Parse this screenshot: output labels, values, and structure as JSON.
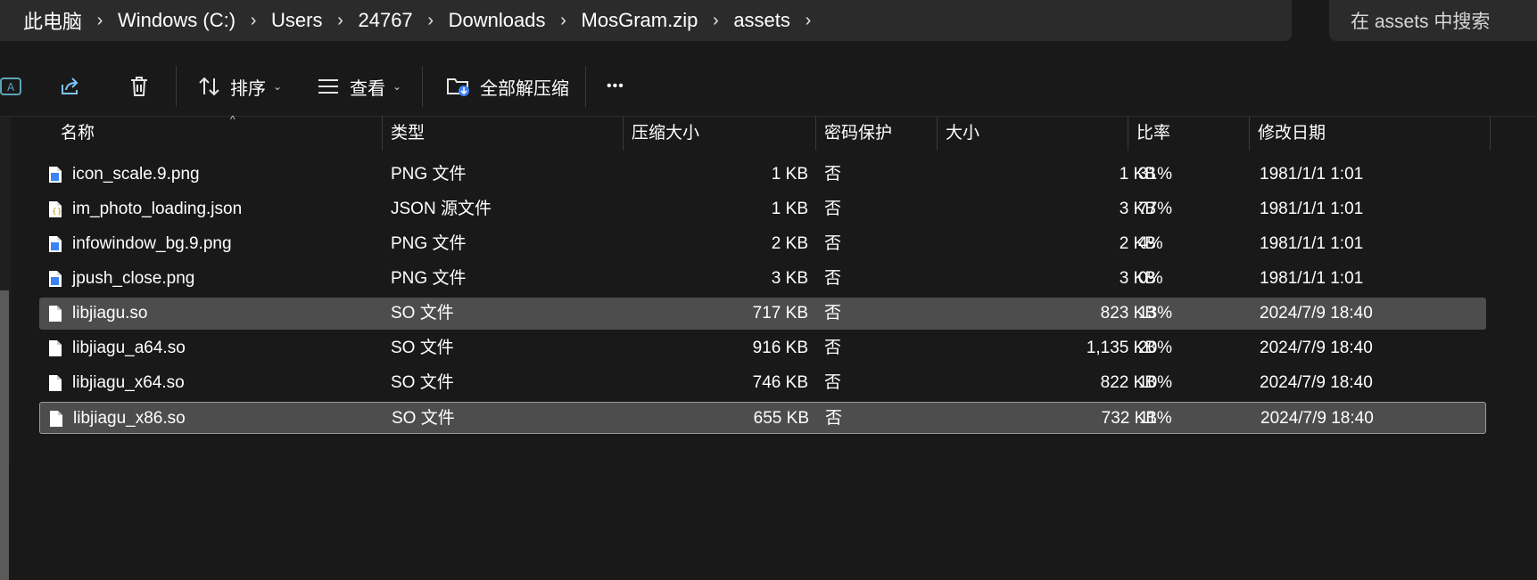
{
  "breadcrumb": [
    "此电脑",
    "Windows  (C:)",
    "Users",
    "24767",
    "Downloads",
    "MosGram.zip",
    "assets"
  ],
  "search": {
    "placeholder": "在 assets 中搜索"
  },
  "toolbar": {
    "sort_label": "排序",
    "view_label": "查看",
    "extract_label": "全部解压缩",
    "more_label": "•••"
  },
  "columns": {
    "name": "名称",
    "type": "类型",
    "compressed": "压缩大小",
    "password": "密码保护",
    "size": "大小",
    "ratio": "比率",
    "modified": "修改日期"
  },
  "files": [
    {
      "name": "icon_scale.9.png",
      "type": "PNG 文件",
      "compressed": "1 KB",
      "password": "否",
      "size": "1 KB",
      "ratio": "31%",
      "modified": "1981/1/1 1:01",
      "icon": "png-file-icon"
    },
    {
      "name": "im_photo_loading.json",
      "type": "JSON 源文件",
      "compressed": "1 KB",
      "password": "否",
      "size": "3 KB",
      "ratio": "77%",
      "modified": "1981/1/1 1:01",
      "icon": "json-file-icon"
    },
    {
      "name": "infowindow_bg.9.png",
      "type": "PNG 文件",
      "compressed": "2 KB",
      "password": "否",
      "size": "2 KB",
      "ratio": "4%",
      "modified": "1981/1/1 1:01",
      "icon": "png-file-icon"
    },
    {
      "name": "jpush_close.png",
      "type": "PNG 文件",
      "compressed": "3 KB",
      "password": "否",
      "size": "3 KB",
      "ratio": "0%",
      "modified": "1981/1/1 1:01",
      "icon": "png-file-icon"
    },
    {
      "name": "libjiagu.so",
      "type": "SO 文件",
      "compressed": "717 KB",
      "password": "否",
      "size": "823 KB",
      "ratio": "13%",
      "modified": "2024/7/9 18:40",
      "icon": "file-icon"
    },
    {
      "name": "libjiagu_a64.so",
      "type": "SO 文件",
      "compressed": "916 KB",
      "password": "否",
      "size": "1,135 KB",
      "ratio": "20%",
      "modified": "2024/7/9 18:40",
      "icon": "file-icon"
    },
    {
      "name": "libjiagu_x64.so",
      "type": "SO 文件",
      "compressed": "746 KB",
      "password": "否",
      "size": "822 KB",
      "ratio": "10%",
      "modified": "2024/7/9 18:40",
      "icon": "file-icon"
    },
    {
      "name": "libjiagu_x86.so",
      "type": "SO 文件",
      "compressed": "655 KB",
      "password": "否",
      "size": "732 KB",
      "ratio": "11%",
      "modified": "2024/7/9 18:40",
      "icon": "file-icon"
    }
  ],
  "selection": {
    "highlighted_row": "libjiagu.so",
    "focused_row": "libjiagu_x86.so"
  },
  "colors": {
    "background": "#191919",
    "bar": "#2b2b2b",
    "selected": "#4d4d4d",
    "png_icon_accent": "#3b82f6"
  }
}
